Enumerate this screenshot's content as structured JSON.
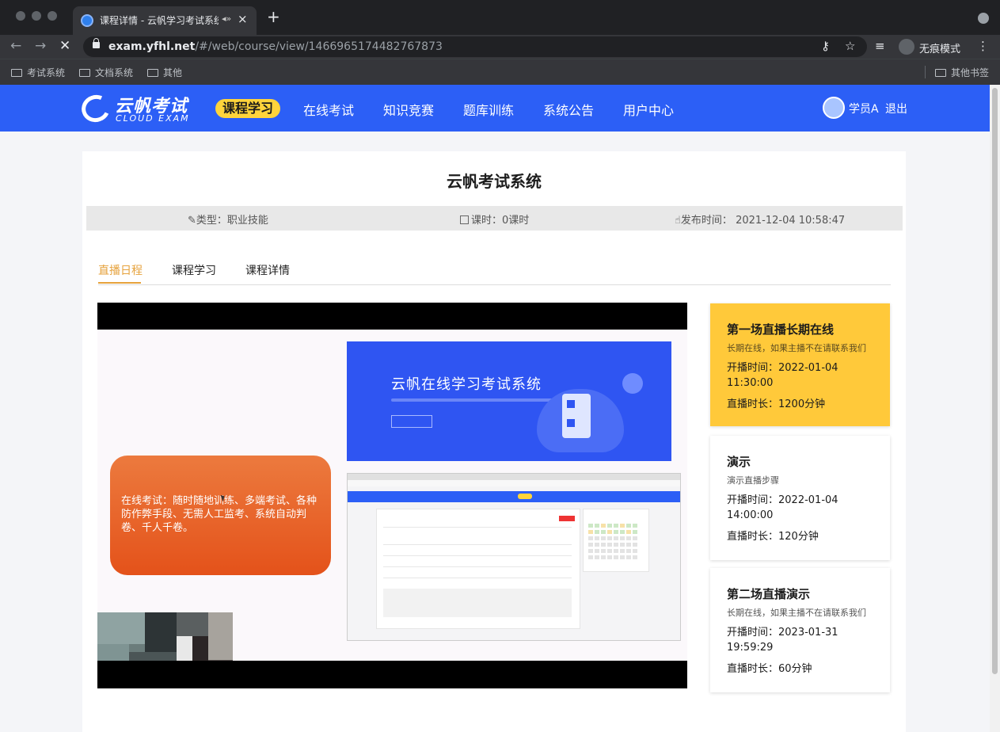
{
  "browser": {
    "tab_title": "课程详情 - 云帆学习考试系统",
    "url_host": "exam.yfhl.net",
    "url_path": "/#/web/course/view/1466965174482767873",
    "incognito_label": "无痕模式",
    "bookmarks": [
      "考试系统",
      "文档系统",
      "其他"
    ],
    "other_bookmarks": "其他书签"
  },
  "header": {
    "logo_cn": "云帆考试",
    "logo_en": "CLOUD EXAM",
    "nav": [
      "课程学习",
      "在线考试",
      "知识竞赛",
      "题库训练",
      "系统公告",
      "用户中心"
    ],
    "active_nav": "课程学习",
    "username": "学员A",
    "logout": "退出"
  },
  "course": {
    "title": "云帆考试系统",
    "type_label": "类型：职业技能",
    "hours_label": "课时：0课时",
    "publish_label": "发布时间：",
    "publish_time": "2021-12-04 10:58:47"
  },
  "tabs": [
    "直播日程",
    "课程学习",
    "课程详情"
  ],
  "video": {
    "banner_title": "云帆在线学习考试系统",
    "slide_text": "在线考试：随时随地训练、多端考试、各种防作弊手段、无需人工监考、系统自动判卷、千人千卷。"
  },
  "schedule": [
    {
      "title": "第一场直播长期在线",
      "desc": "长期在线，如果主播不在请联系我们",
      "start_label": "开播时间：",
      "start_date": "2022-01-04",
      "start_time": "11:30:00",
      "duration": "直播时长：1200分钟"
    },
    {
      "title": "演示",
      "desc": "演示直播步骤",
      "start_label": "开播时间：",
      "start_date": "2022-01-04",
      "start_time": "14:00:00",
      "duration": "直播时长：120分钟"
    },
    {
      "title": "第二场直播演示",
      "desc": "长期在线，如果主播不在请联系我们",
      "start_label": "开播时间：",
      "start_date": "2023-01-31",
      "start_time": "19:59:29",
      "duration": "直播时长：60分钟"
    }
  ],
  "colors": {
    "brand_blue": "#2c5ff6",
    "accent_yellow": "#ffd43b",
    "tab_active": "#e6a23c",
    "card_active": "#ffc93a"
  }
}
